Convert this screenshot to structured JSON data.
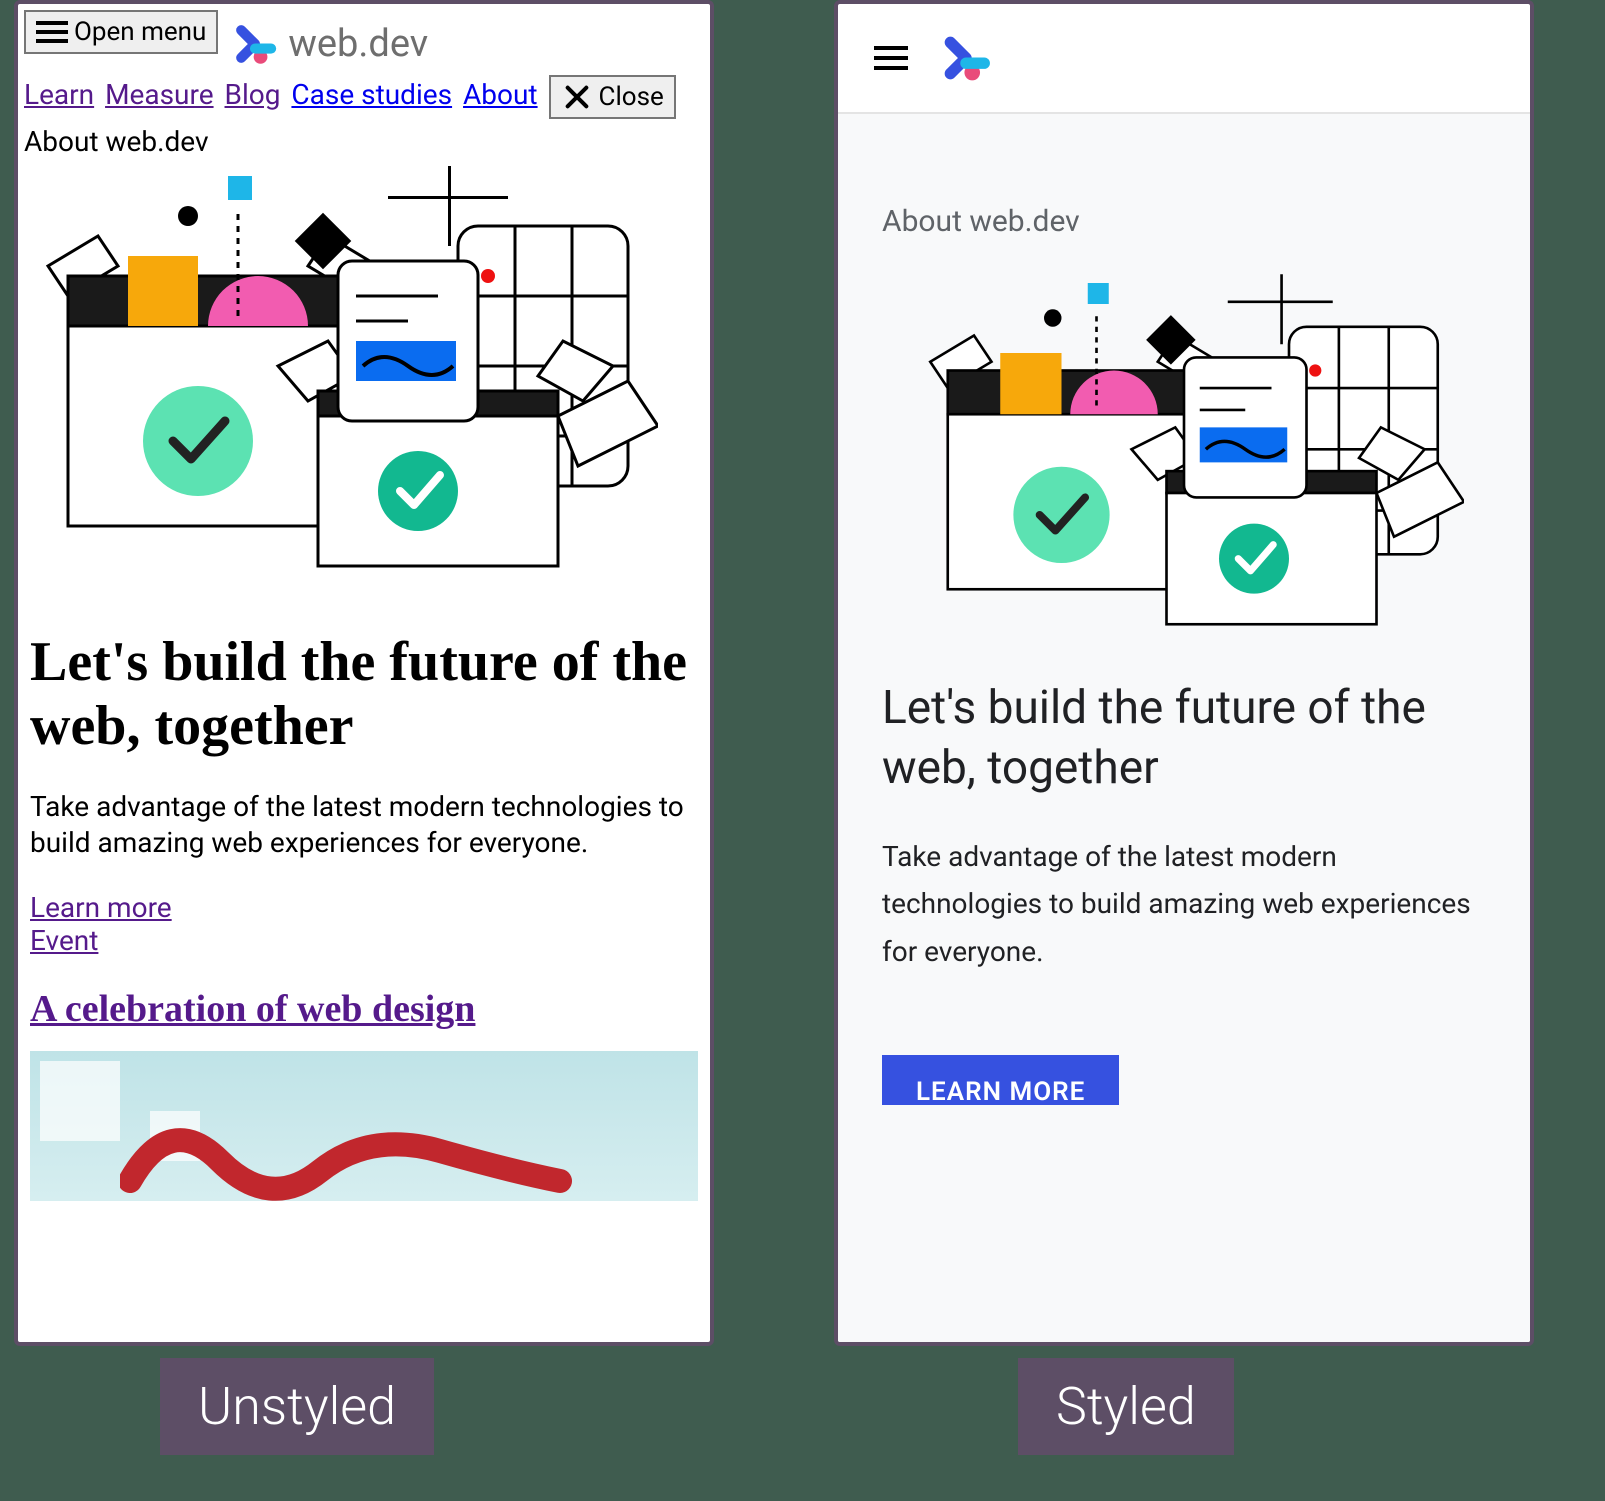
{
  "captions": {
    "left": "Unstyled",
    "right": "Styled"
  },
  "brand": "web.dev",
  "unstyled": {
    "open_menu": "Open menu",
    "close": "Close",
    "nav": {
      "learn": "Learn",
      "measure": "Measure",
      "blog": "Blog",
      "case_studies": "Case studies",
      "about": "About"
    },
    "eyebrow": "About web.dev",
    "h1": "Let's build the future of the web, together",
    "p": "Take advantage of the latest modern technologies to build amazing web experiences for everyone.",
    "learn_more": "Learn more",
    "event": "Event",
    "h2": "A celebration of web design"
  },
  "styled": {
    "eyebrow": "About web.dev",
    "h1": "Let's build the future of the web, together",
    "p": "Take advantage of the latest modern technologies to build amazing web experiences for everyone.",
    "cta": "LEARN MORE"
  }
}
